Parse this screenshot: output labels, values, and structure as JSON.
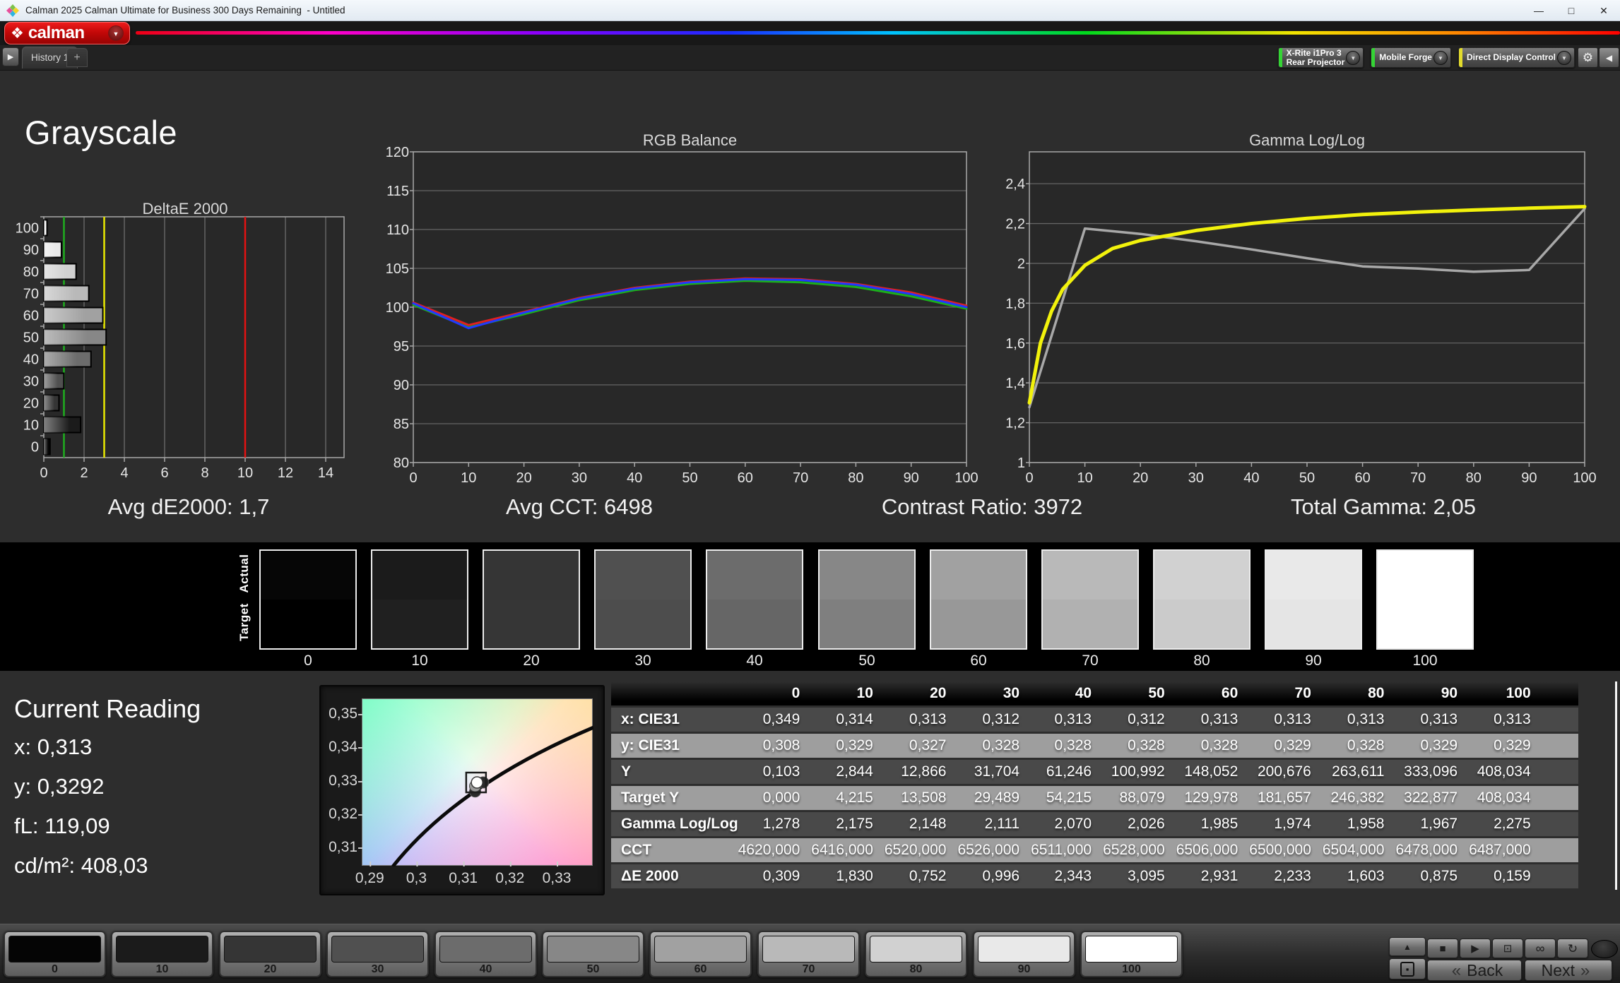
{
  "window": {
    "title": "Calman 2025 Calman Ultimate for Business 300 Days Remaining  - Untitled",
    "minimize": "—",
    "maximize": "□",
    "close": "✕"
  },
  "brand": {
    "logo_icon": "❖",
    "logo_text": "calman",
    "dropdown_icon": "▼"
  },
  "meters": [
    {
      "line1": "X-Rite i1Pro 3",
      "line2": "Rear Projector",
      "accent": "#35d435"
    },
    {
      "line1": "Mobile Forge",
      "line2": "",
      "accent": "#35d435"
    },
    {
      "line1": "Direct Display Control",
      "line2": "",
      "accent": "#e3dc2d"
    }
  ],
  "toolbar": {
    "tab_scroll_icon": "▶",
    "gear_icon": "⚙",
    "collapse_icon": "◀"
  },
  "tabs": {
    "history": "History 1",
    "add": "+"
  },
  "page": {
    "title": "Grayscale"
  },
  "charts": {
    "deltae": {
      "title": "DeltaE 2000",
      "xticks": [
        0,
        2,
        4,
        6,
        8,
        10,
        12,
        14
      ],
      "bars": [
        {
          "level": "100",
          "value": 0.159
        },
        {
          "level": "90",
          "value": 0.875
        },
        {
          "level": "80",
          "value": 1.603
        },
        {
          "level": "70",
          "value": 2.233
        },
        {
          "level": "60",
          "value": 2.931
        },
        {
          "level": "50",
          "value": 3.095
        },
        {
          "level": "40",
          "value": 2.343
        },
        {
          "level": "30",
          "value": 0.996
        },
        {
          "level": "20",
          "value": 0.752
        },
        {
          "level": "10",
          "value": 1.83
        },
        {
          "level": "0",
          "value": 0.309
        }
      ],
      "limits": [
        {
          "value": 1,
          "color": "#1fae1f"
        },
        {
          "value": 3,
          "color": "#e8e800"
        },
        {
          "value": 10,
          "color": "#e31212"
        }
      ]
    },
    "rgb": {
      "title": "RGB Balance",
      "ymin": 80,
      "ymax": 120,
      "ystep": 5,
      "xticks": [
        0,
        10,
        20,
        30,
        40,
        50,
        60,
        70,
        80,
        90,
        100
      ],
      "series": [
        {
          "name": "green",
          "color": "#1cb01c",
          "width": 3,
          "points": [
            [
              0,
              100.3
            ],
            [
              10,
              97.4
            ],
            [
              20,
              99.1
            ],
            [
              30,
              100.9
            ],
            [
              40,
              102.2
            ],
            [
              50,
              103.0
            ],
            [
              60,
              103.4
            ],
            [
              70,
              103.2
            ],
            [
              80,
              102.6
            ],
            [
              90,
              101.4
            ],
            [
              100,
              99.8
            ]
          ]
        },
        {
          "name": "red",
          "color": "#e02020",
          "width": 3,
          "points": [
            [
              0,
              100.6
            ],
            [
              10,
              97.7
            ],
            [
              20,
              99.4
            ],
            [
              30,
              101.2
            ],
            [
              40,
              102.5
            ],
            [
              50,
              103.3
            ],
            [
              60,
              103.7
            ],
            [
              70,
              103.6
            ],
            [
              80,
              103.0
            ],
            [
              90,
              101.9
            ],
            [
              100,
              100.2
            ]
          ]
        },
        {
          "name": "blue",
          "color": "#2238ff",
          "width": 3,
          "points": [
            [
              0,
              100.5
            ],
            [
              10,
              97.3
            ],
            [
              20,
              99.3
            ],
            [
              30,
              101.1
            ],
            [
              40,
              102.4
            ],
            [
              50,
              103.2
            ],
            [
              60,
              103.6
            ],
            [
              70,
              103.5
            ],
            [
              80,
              102.9
            ],
            [
              90,
              101.7
            ],
            [
              100,
              100.0
            ]
          ]
        }
      ]
    },
    "gamma": {
      "title": "Gamma Log/Log",
      "ymin": 1,
      "ytop": 2.56,
      "yticks": [
        {
          "v": 2.4,
          "label": "2,4"
        },
        {
          "v": 2.2,
          "label": "2,2"
        },
        {
          "v": 2.0,
          "label": "2"
        },
        {
          "v": 1.8,
          "label": "1,8"
        },
        {
          "v": 1.6,
          "label": "1,6"
        },
        {
          "v": 1.4,
          "label": "1,4"
        },
        {
          "v": 1.2,
          "label": "1,2"
        },
        {
          "v": 1.0,
          "label": "1"
        }
      ],
      "xticks": [
        0,
        10,
        20,
        30,
        40,
        50,
        60,
        70,
        80,
        90,
        100
      ],
      "series": [
        {
          "name": "measured",
          "color": "#a8a8a8",
          "width": 3.5,
          "points": [
            [
              0,
              1.278
            ],
            [
              10,
              2.175
            ],
            [
              20,
              2.148
            ],
            [
              30,
              2.111
            ],
            [
              40,
              2.07
            ],
            [
              50,
              2.026
            ],
            [
              60,
              1.985
            ],
            [
              70,
              1.974
            ],
            [
              80,
              1.958
            ],
            [
              90,
              1.967
            ],
            [
              100,
              2.275
            ]
          ]
        },
        {
          "name": "target",
          "color": "#f2f20c",
          "width": 5,
          "points": [
            [
              0,
              1.3
            ],
            [
              2,
              1.6
            ],
            [
              4,
              1.76
            ],
            [
              6,
              1.87
            ],
            [
              8,
              1.93
            ],
            [
              10,
              1.99
            ],
            [
              15,
              2.075
            ],
            [
              20,
              2.115
            ],
            [
              30,
              2.165
            ],
            [
              40,
              2.2
            ],
            [
              50,
              2.226
            ],
            [
              60,
              2.245
            ],
            [
              70,
              2.258
            ],
            [
              80,
              2.268
            ],
            [
              90,
              2.277
            ],
            [
              100,
              2.285
            ]
          ]
        }
      ]
    }
  },
  "stats": [
    "Avg dE2000: 1,7",
    "Avg CCT: 6498",
    "Contrast Ratio: 3972",
    "Total Gamma: 2,05"
  ],
  "strip": {
    "row_labels": [
      "Actual",
      "Target"
    ],
    "levels": [
      {
        "label": "0",
        "actual": "#060606",
        "target": "#000000"
      },
      {
        "label": "10",
        "actual": "#1b1b1b",
        "target": "#202020"
      },
      {
        "label": "20",
        "actual": "#353535",
        "target": "#363636"
      },
      {
        "label": "30",
        "actual": "#505050",
        "target": "#4d4d4d"
      },
      {
        "label": "40",
        "actual": "#6c6c6c",
        "target": "#666666"
      },
      {
        "label": "50",
        "actual": "#878787",
        "target": "#7f7f7f"
      },
      {
        "label": "60",
        "actual": "#a1a1a1",
        "target": "#989898"
      },
      {
        "label": "70",
        "actual": "#b9b9b9",
        "target": "#b1b1b1"
      },
      {
        "label": "80",
        "actual": "#d1d1d1",
        "target": "#cbcbcb"
      },
      {
        "label": "90",
        "actual": "#e9e9e9",
        "target": "#e5e5e5"
      },
      {
        "label": "100",
        "actual": "#ffffff",
        "target": "#ffffff"
      }
    ]
  },
  "reading": {
    "title": "Current Reading",
    "lines": [
      "x: 0,313",
      "y: 0,3292",
      "fL: 119,09",
      "cd/m²: 408,03"
    ]
  },
  "cie": {
    "xmin": 0.2883,
    "xmax": 0.3377,
    "ymin": 0.3045,
    "ymax": 0.3547,
    "yticks": [
      {
        "v": 0.35,
        "label": "0,35"
      },
      {
        "v": 0.34,
        "label": "0,34"
      },
      {
        "v": 0.33,
        "label": "0,33"
      },
      {
        "v": 0.32,
        "label": "0,32"
      },
      {
        "v": 0.31,
        "label": "0,31"
      }
    ],
    "xticks": [
      {
        "v": 0.29,
        "label": "0,29"
      },
      {
        "v": 0.3,
        "label": "0,3"
      },
      {
        "v": 0.31,
        "label": "0,31"
      },
      {
        "v": 0.32,
        "label": "0,32"
      },
      {
        "v": 0.33,
        "label": "0,33"
      }
    ],
    "locus": [
      [
        0.2948,
        0.3045
      ],
      [
        0.3125,
        0.3272
      ],
      [
        0.3377,
        0.3462
      ]
    ],
    "points": {
      "white": [
        0.3128,
        0.3297
      ],
      "gray": [
        0.3124,
        0.3286
      ],
      "dark1": [
        0.3141,
        0.3297
      ],
      "dark2": [
        0.3124,
        0.327
      ],
      "square": [
        0.3126,
        0.3297
      ]
    }
  },
  "table": {
    "columns": [
      "0",
      "10",
      "20",
      "30",
      "40",
      "50",
      "60",
      "70",
      "80",
      "90",
      "100"
    ],
    "rows": [
      {
        "label": "x: CIE31",
        "values": [
          "0,349",
          "0,314",
          "0,313",
          "0,312",
          "0,313",
          "0,312",
          "0,313",
          "0,313",
          "0,313",
          "0,313",
          "0,313"
        ]
      },
      {
        "label": "y: CIE31",
        "values": [
          "0,308",
          "0,329",
          "0,327",
          "0,328",
          "0,328",
          "0,328",
          "0,328",
          "0,329",
          "0,328",
          "0,329",
          "0,329"
        ]
      },
      {
        "label": "Y",
        "values": [
          "0,103",
          "2,844",
          "12,866",
          "31,704",
          "61,246",
          "100,992",
          "148,052",
          "200,676",
          "263,611",
          "333,096",
          "408,034"
        ]
      },
      {
        "label": "Target Y",
        "values": [
          "0,000",
          "4,215",
          "13,508",
          "29,489",
          "54,215",
          "88,079",
          "129,978",
          "181,657",
          "246,382",
          "322,877",
          "408,034"
        ]
      },
      {
        "label": "Gamma Log/Log",
        "values": [
          "1,278",
          "2,175",
          "2,148",
          "2,111",
          "2,070",
          "2,026",
          "1,985",
          "1,974",
          "1,958",
          "1,967",
          "2,275"
        ]
      },
      {
        "label": "CCT",
        "values": [
          "4620,000",
          "6416,000",
          "6520,000",
          "6526,000",
          "6511,000",
          "6528,000",
          "6506,000",
          "6500,000",
          "6504,000",
          "6478,000",
          "6487,000"
        ]
      },
      {
        "label": "ΔE 2000",
        "values": [
          "0,309",
          "1,830",
          "0,752",
          "0,996",
          "2,343",
          "3,095",
          "2,931",
          "2,233",
          "1,603",
          "0,875",
          "0,159"
        ]
      }
    ]
  },
  "bottombar": {
    "patterns": [
      {
        "label": "0",
        "color": "#050505"
      },
      {
        "label": "10",
        "color": "#1b1b1b"
      },
      {
        "label": "20",
        "color": "#353535"
      },
      {
        "label": "30",
        "color": "#505050"
      },
      {
        "label": "40",
        "color": "#6c6c6c"
      },
      {
        "label": "50",
        "color": "#878787"
      },
      {
        "label": "60",
        "color": "#a1a1a1"
      },
      {
        "label": "70",
        "color": "#b9b9b9"
      },
      {
        "label": "80",
        "color": "#d1d1d1"
      },
      {
        "label": "90",
        "color": "#e9e9e9"
      },
      {
        "label": "100",
        "color": "#ffffff"
      }
    ],
    "transport": {
      "up": "▲",
      "framed_square": "▪",
      "stop": "■",
      "play": "▶",
      "pattern_window": "⊡",
      "continuous": "∞",
      "repeat": "↻"
    },
    "back_chevron": "«",
    "back_label": "Back",
    "next_chevron": "»",
    "next_label": "Next"
  }
}
